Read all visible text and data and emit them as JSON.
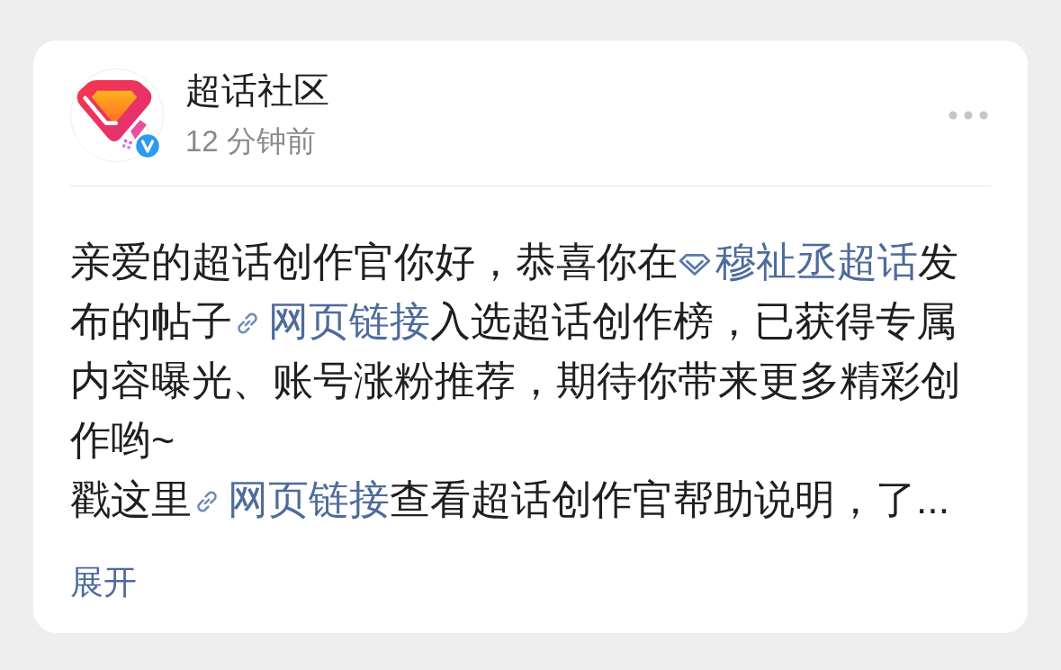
{
  "post": {
    "author": {
      "name": "超话社区",
      "verified": true
    },
    "time": "12 分钟前",
    "body": [
      {
        "segments": [
          {
            "kind": "text",
            "text": "亲爱的超话创作官你好，恭喜你在"
          },
          {
            "kind": "topic",
            "text": "穆祉丞超话"
          },
          {
            "kind": "text",
            "text": "发布的帖子"
          },
          {
            "kind": "link",
            "text": "网页链接"
          },
          {
            "kind": "text",
            "text": "入选超话创作榜，已获得专属内容曝光、账号涨粉推荐，期待你带来更多精彩创作哟~"
          }
        ]
      },
      {
        "segments": [
          {
            "kind": "text",
            "text": "戳这里"
          },
          {
            "kind": "link",
            "text": "网页链接"
          },
          {
            "kind": "text",
            "text": "查看超话创作官帮助说明，了..."
          }
        ]
      }
    ],
    "expand": "展开"
  }
}
